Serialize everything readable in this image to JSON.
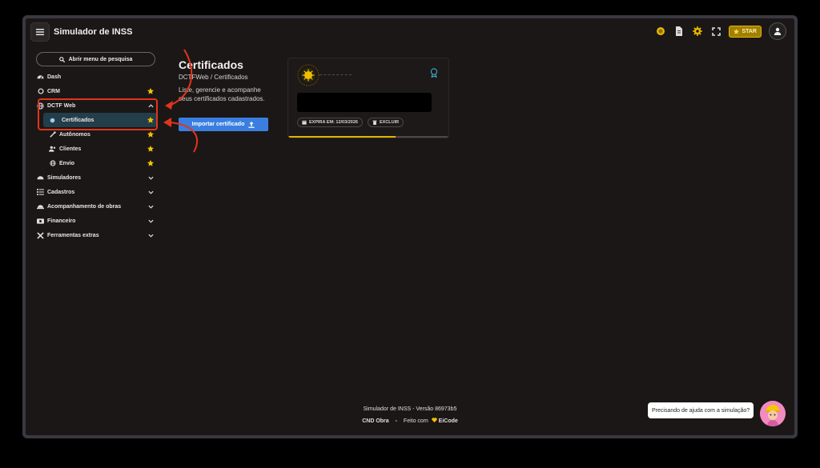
{
  "header": {
    "app_title": "Simulador de INSS",
    "star_label": "STAR"
  },
  "sidebar": {
    "search_label": "Abrir menu de pesquisa",
    "items": [
      {
        "label": "Dash"
      },
      {
        "label": "CRM"
      },
      {
        "label": "DCTF Web"
      },
      {
        "label": "Certificados"
      },
      {
        "label": "Autônomos"
      },
      {
        "label": "Clientes"
      },
      {
        "label": "Envio"
      },
      {
        "label": "Simuladores"
      },
      {
        "label": "Cadastros"
      },
      {
        "label": "Acompanhamento de obras"
      },
      {
        "label": "Financeiro"
      },
      {
        "label": "Ferramentas extras"
      }
    ]
  },
  "main": {
    "title": "Certificados",
    "breadcrumb": "DCTFWeb / Certificados",
    "description": "Liste, gerencie e acompanhe seus certificados cadastrados.",
    "import_button": "Importar certificado"
  },
  "certificate": {
    "expires_label": "EXPIRA EM: 12/03/2026",
    "delete_label": "EXCLUIR",
    "progress": 0.67
  },
  "footer": {
    "version": "Simulador de INSS - Versão 86973b5",
    "left": "CND Obra",
    "separator": "-",
    "made_with": "Feito com",
    "brand": "EiCode"
  },
  "help": {
    "bubble": "Precisando de ajuda com a simulação?"
  },
  "colors": {
    "background": "#1b1716",
    "accent_blue": "#3a7fe0",
    "accent_yellow": "#e6b800",
    "annotation_red": "#e2341c"
  }
}
